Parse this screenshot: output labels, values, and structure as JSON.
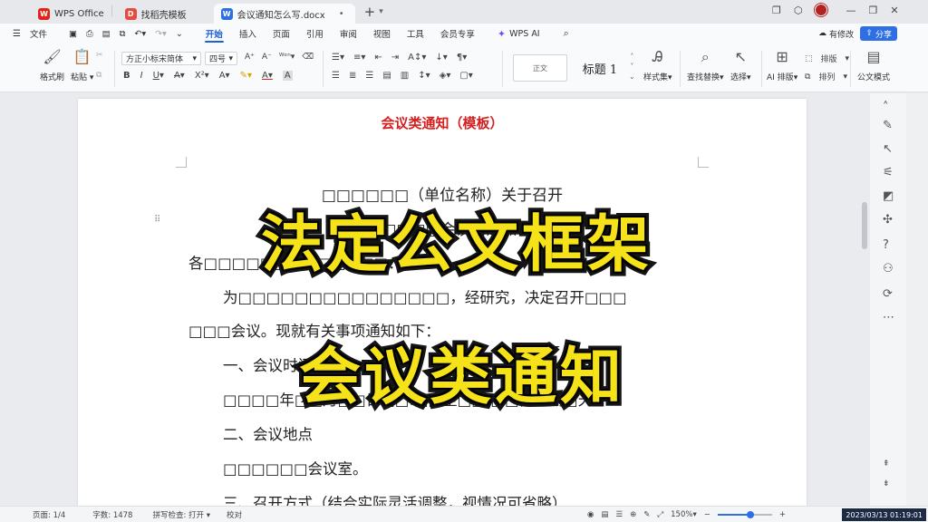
{
  "tabs": [
    {
      "label": "WPS Office",
      "logo": "W"
    },
    {
      "label": "找稻壳模板",
      "logo": "D"
    },
    {
      "label": "会议通知怎么写.docx",
      "logo": "W"
    }
  ],
  "title_right": {
    "logo_color": "#e2231a"
  },
  "menu": {
    "file": "文件",
    "tabs": [
      "开始",
      "插入",
      "页面",
      "引用",
      "审阅",
      "视图",
      "工具",
      "会员专享"
    ],
    "ai": "WPS AI",
    "modify": "有修改",
    "share": "分享"
  },
  "ribbon": {
    "format_painter": "格式刷",
    "paste": "粘贴",
    "font_name": "方正小标宋简体",
    "font_size": "四号",
    "bold": "B",
    "italic": "I",
    "underline": "U",
    "strike": "A",
    "superscript": "X²",
    "style_normal": "正文",
    "style_heading": "标题 1",
    "style_set": "样式集",
    "find_replace": "查找替换",
    "select": "选择",
    "ai_layout": "AI 排版",
    "layout": "排版",
    "arrange": "排列",
    "doc_mode": "公文模式"
  },
  "document": {
    "template_title": "会议类通知（模板）",
    "title_line1": "□□□□□□（单位名称）关于召开",
    "title_line2": "□□□□□会议的通知",
    "salutation": "各□□□□□□、□□□□□□：",
    "para1": "为□□□□□□□□□□□□□□□，经研究，决定召开□□□",
    "para1_cont": "□□□会议。现就有关事项通知如下：",
    "h1": "一、会议时间",
    "h1_body": "□□□□年□□月□□日□□:□□至□□:□□，会期□天。",
    "h2": "二、会议地点",
    "h2_body": "□□□□□□会议室。",
    "h3": "三、召开方式（结合实际灵活调整，视情况可省略）"
  },
  "overlay": {
    "line1": "法定公文框架",
    "line2": "会议类通知"
  },
  "status": {
    "page": "页面: 1/4",
    "words": "字数: 1478",
    "spell": "拼写检查: 打开",
    "proof": "校对",
    "zoom": "150%",
    "zoom_level": 0.6,
    "timestamp": "2023/03/13 01:19:01"
  },
  "colors": {
    "accent": "#1f5fd6",
    "template_title": "#d42020",
    "overlay_fill": "#f6e219",
    "wps_red": "#e2231a"
  }
}
